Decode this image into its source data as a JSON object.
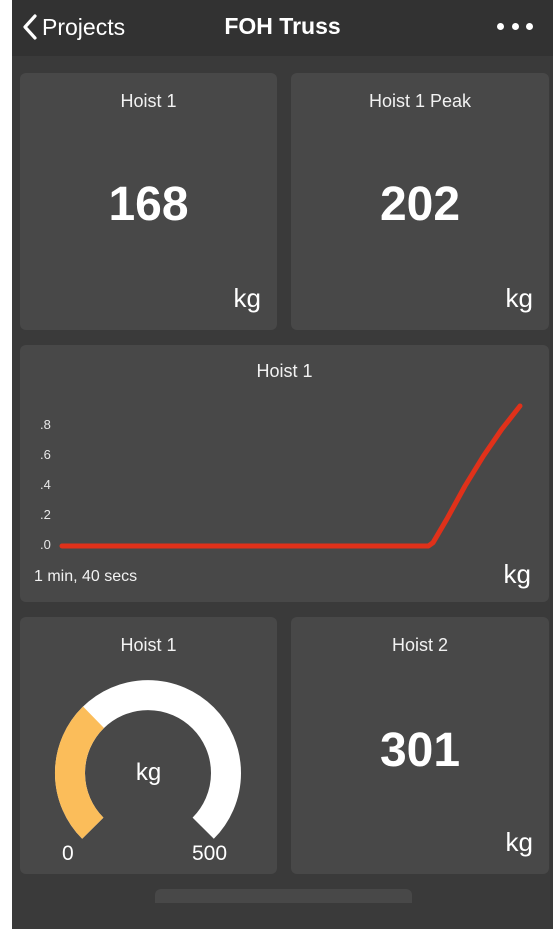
{
  "navbar": {
    "back_label": "Projects",
    "title": "FOH Truss",
    "more_icon": "ellipsis-icon"
  },
  "tiles": {
    "hoist1": {
      "title": "Hoist 1",
      "value": "168",
      "unit": "kg"
    },
    "hoist1_peak": {
      "title": "Hoist 1 Peak",
      "value": "202",
      "unit": "kg"
    },
    "hoist1_chart": {
      "title": "Hoist 1",
      "duration": "1 min, 40 secs",
      "unit": "kg"
    },
    "hoist1_gauge": {
      "title": "Hoist 1",
      "unit": "kg",
      "min": "0",
      "max": "500",
      "fill_fraction": 0.336
    },
    "hoist2": {
      "title": "Hoist 2",
      "value": "301",
      "unit": "kg"
    }
  },
  "colors": {
    "background": "#3a3a3a",
    "tile": "#484848",
    "line": "#e0311a",
    "gauge_fill": "#fbbd5a",
    "gauge_track": "#ffffff"
  },
  "chart_data": {
    "type": "line",
    "title": "Hoist 1",
    "xlabel": "1 min, 40 secs",
    "ylabel": "kg",
    "yticks": [
      ".0",
      ".2",
      ".4",
      ".6",
      ".8"
    ],
    "ylim": [
      0,
      0.9
    ],
    "x": [
      0,
      10,
      20,
      30,
      40,
      50,
      60,
      70,
      80,
      81,
      84,
      88,
      92,
      96,
      100
    ],
    "values": [
      0,
      0,
      0,
      0,
      0,
      0,
      0,
      0,
      0,
      0.02,
      0.16,
      0.36,
      0.54,
      0.7,
      0.84
    ],
    "grid": false
  }
}
